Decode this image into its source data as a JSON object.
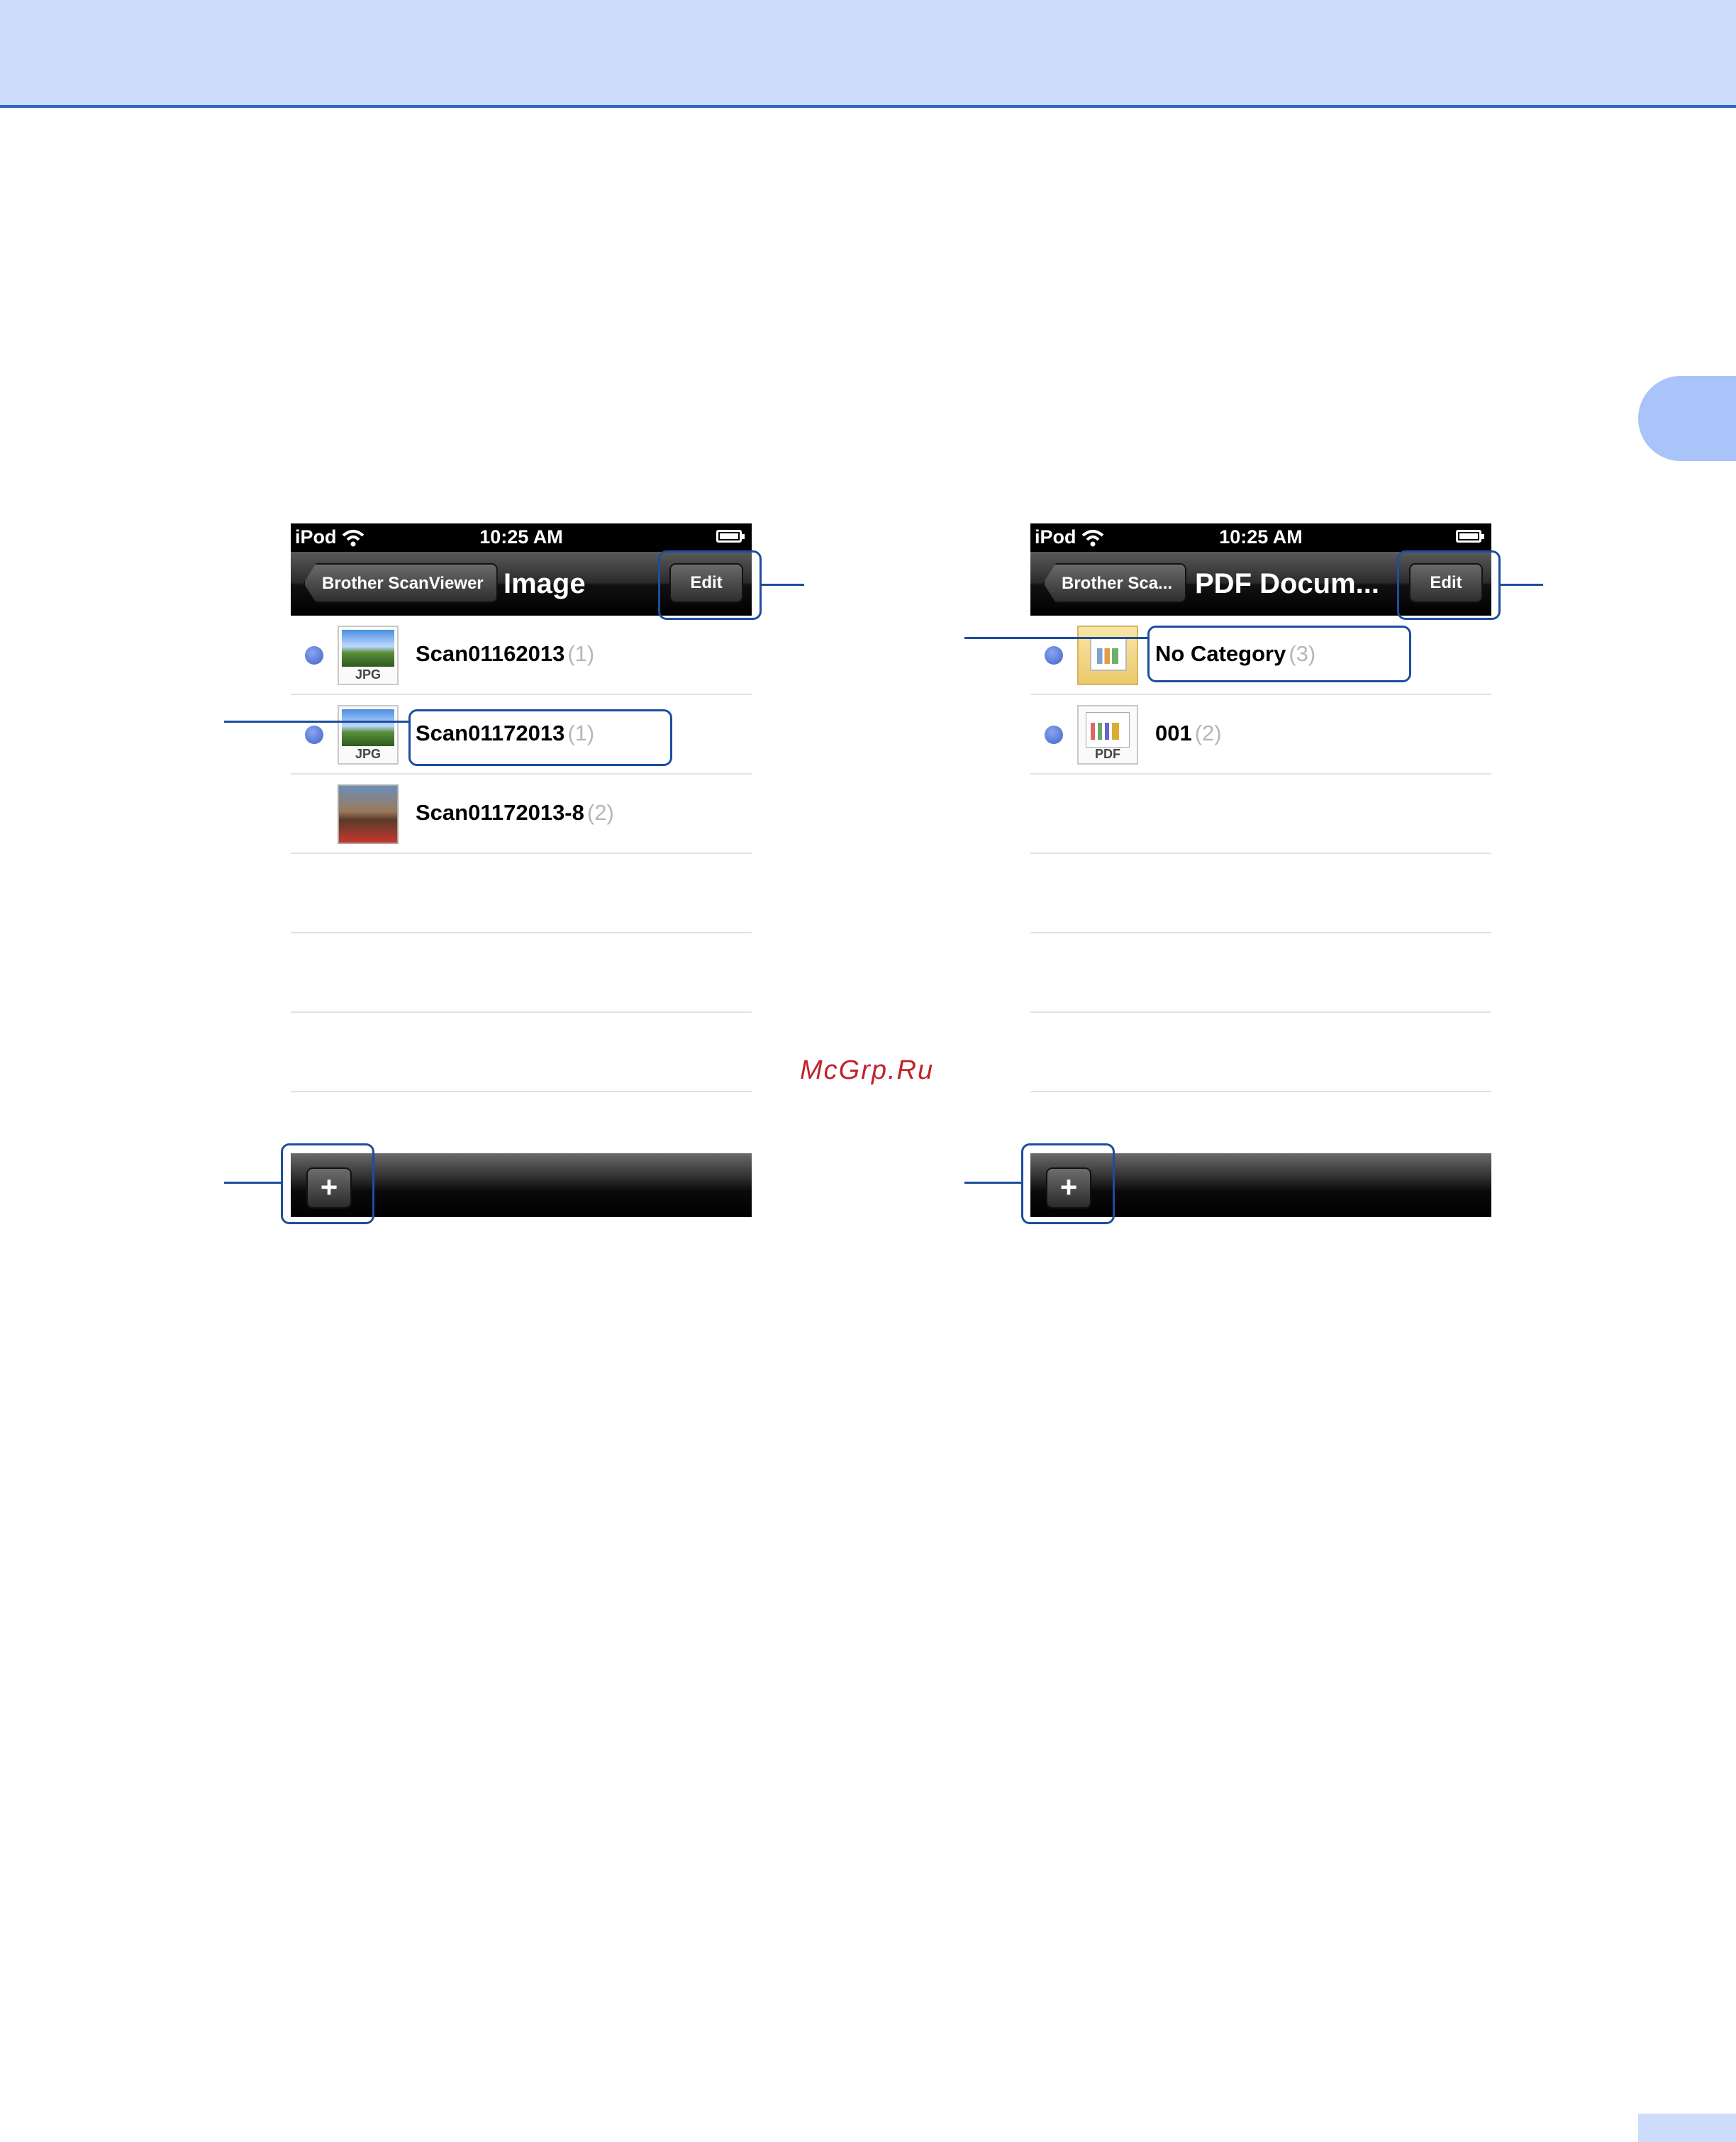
{
  "page": {
    "watermark": "McGrp.Ru"
  },
  "left_screen": {
    "status": {
      "device": "iPod",
      "time": "10:25 AM"
    },
    "nav": {
      "back_label": "Brother ScanViewer",
      "title": "Image",
      "edit_label": "Edit"
    },
    "rows": [
      {
        "title": "Scan01162013",
        "count": "(1)",
        "unread": true,
        "thumb": "jpg-icon",
        "thumb_label": "JPG"
      },
      {
        "title": "Scan01172013",
        "count": "(1)",
        "unread": true,
        "thumb": "jpg-icon",
        "thumb_label": "JPG"
      },
      {
        "title": "Scan01172013-8",
        "count": "(2)",
        "unread": false,
        "thumb": "photo-thumbnail"
      }
    ],
    "toolbar": {
      "add_label": "+"
    }
  },
  "right_screen": {
    "status": {
      "device": "iPod",
      "time": "10:25 AM"
    },
    "nav": {
      "back_label": "Brother Sca...",
      "title": "PDF Docum...",
      "edit_label": "Edit"
    },
    "rows": [
      {
        "title": "No Category",
        "count": "(3)",
        "unread": true,
        "thumb": "folder-icon"
      },
      {
        "title": "001",
        "count": "(2)",
        "unread": true,
        "thumb": "pdf-icon",
        "thumb_label": "PDF"
      }
    ],
    "toolbar": {
      "add_label": "+"
    }
  },
  "colors": {
    "header_band": "#cddcfb",
    "header_rule": "#2a64c8",
    "callout": "#1c4e9c",
    "unread_dot": "#4a6ed0",
    "count_gray": "#b6b6b6",
    "watermark": "#c0242a"
  }
}
